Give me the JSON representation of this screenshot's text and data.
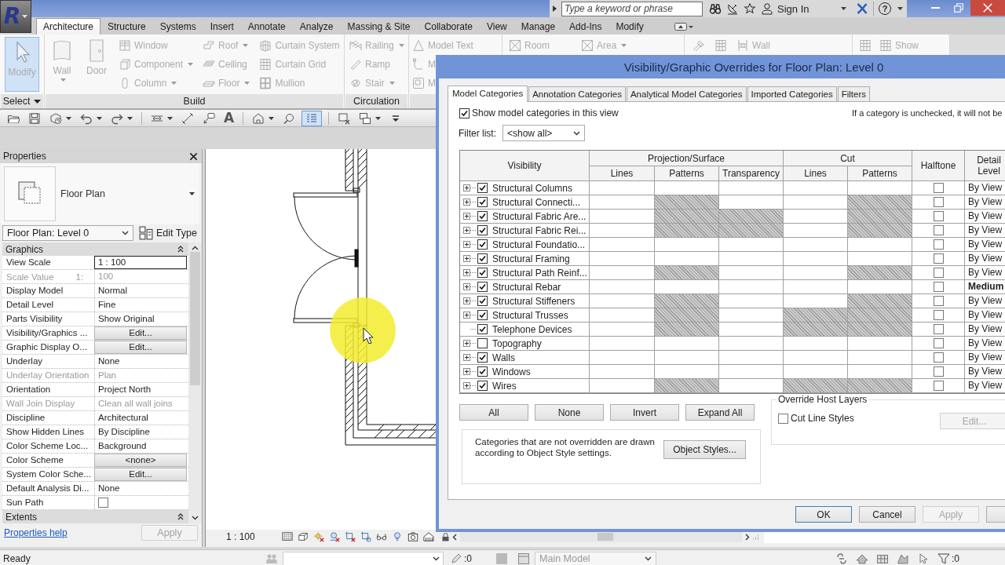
{
  "app_menu": {
    "logo": "R"
  },
  "title_bar": {
    "search": {
      "placeholder": "Type a keyword or phrase"
    },
    "sign_in": "Sign In",
    "help": "?"
  },
  "ribbon_tabs": [
    {
      "label": "Architecture",
      "selected": true
    },
    {
      "label": "Structure",
      "selected": false
    },
    {
      "label": "Systems",
      "selected": false
    },
    {
      "label": "Insert",
      "selected": false
    },
    {
      "label": "Annotate",
      "selected": false
    },
    {
      "label": "Analyze",
      "selected": false
    },
    {
      "label": "Massing & Site",
      "selected": false
    },
    {
      "label": "Collaborate",
      "selected": false
    },
    {
      "label": "View",
      "selected": false
    },
    {
      "label": "Manage",
      "selected": false
    },
    {
      "label": "Add-Ins",
      "selected": false
    },
    {
      "label": "Modify",
      "selected": false
    }
  ],
  "ribbon_panels": [
    {
      "label": "Select",
      "dropdown": true,
      "columns": [
        [
          {
            "label": "Modify",
            "kind": "large",
            "dropdown": false,
            "active": true,
            "disabled": true
          }
        ]
      ]
    },
    {
      "label": "Build",
      "dropdown": false,
      "columns": [
        [
          {
            "label": "Wall",
            "kind": "large",
            "dropdown": true,
            "active": false,
            "disabled": true
          }
        ],
        [
          {
            "label": "Door",
            "kind": "large",
            "dropdown": false,
            "active": false,
            "disabled": true
          }
        ],
        [
          {
            "label": "Window",
            "kind": "small",
            "dropdown": false,
            "active": false,
            "disabled": true
          },
          {
            "label": "Component",
            "kind": "small",
            "dropdown": true,
            "active": false,
            "disabled": true
          },
          {
            "label": "Column",
            "kind": "small",
            "dropdown": true,
            "active": false,
            "disabled": true
          }
        ],
        [
          {
            "label": "Roof",
            "kind": "small",
            "dropdown": true,
            "active": false,
            "disabled": true
          },
          {
            "label": "Ceiling",
            "kind": "small",
            "dropdown": false,
            "active": false,
            "disabled": true
          },
          {
            "label": "Floor",
            "kind": "small",
            "dropdown": true,
            "active": false,
            "disabled": true
          }
        ],
        [
          {
            "label": "Curtain System",
            "kind": "small",
            "dropdown": false,
            "active": false,
            "disabled": true
          },
          {
            "label": "Curtain Grid",
            "kind": "small",
            "dropdown": false,
            "active": false,
            "disabled": true
          },
          {
            "label": "Mullion",
            "kind": "small",
            "dropdown": false,
            "active": false,
            "disabled": true
          }
        ]
      ]
    },
    {
      "label": "Circulation",
      "dropdown": false,
      "columns": [
        [
          {
            "label": "Railing",
            "kind": "small",
            "dropdown": true,
            "active": false,
            "disabled": true
          },
          {
            "label": "Ramp",
            "kind": "small",
            "dropdown": false,
            "active": false,
            "disabled": true
          },
          {
            "label": "Stair",
            "kind": "small",
            "dropdown": true,
            "active": false,
            "disabled": true
          }
        ]
      ]
    },
    {
      "columns": [
        [
          {
            "label": "Model Text",
            "kind": "small",
            "dropdown": false,
            "active": false,
            "disabled": true
          },
          {
            "label": "M",
            "kind": "small",
            "dropdown": false,
            "active": false,
            "disabled": true
          },
          {
            "label": "M",
            "kind": "small",
            "dropdown": false,
            "active": false,
            "disabled": true
          }
        ]
      ]
    },
    {
      "columns": [
        [
          {
            "label": "Room",
            "kind": "small",
            "dropdown": false,
            "active": false,
            "disabled": true
          }
        ],
        [
          {
            "label": "Area",
            "kind": "small",
            "dropdown": true,
            "active": false,
            "disabled": true
          }
        ]
      ]
    },
    {
      "columns": [
        [
          {
            "kind": "small",
            "dropdown": false,
            "active": false,
            "disabled": true
          }
        ],
        [
          {
            "kind": "small",
            "dropdown": false,
            "active": false,
            "disabled": true
          }
        ],
        [
          {
            "label": "Wall",
            "kind": "small",
            "dropdown": false,
            "active": false,
            "disabled": true
          }
        ]
      ]
    },
    {
      "columns": [
        [
          {
            "kind": "small",
            "dropdown": false,
            "active": false,
            "disabled": true
          }
        ],
        [
          {
            "label": "Show",
            "kind": "small",
            "dropdown": false,
            "active": false,
            "disabled": true
          }
        ]
      ]
    }
  ],
  "quick_access": [
    {
      "kind": "button",
      "dropdown": false,
      "active": false
    },
    {
      "kind": "button",
      "dropdown": false,
      "active": false
    },
    {
      "kind": "button",
      "dropdown": true,
      "active": false
    },
    {
      "kind": "button",
      "dropdown": true,
      "active": false
    },
    {
      "kind": "button",
      "dropdown": true,
      "active": false
    },
    {
      "kind": "separator"
    },
    {
      "kind": "button",
      "dropdown": true,
      "active": false
    },
    {
      "kind": "button",
      "dropdown": false,
      "active": false
    },
    {
      "kind": "button",
      "dropdown": false,
      "active": false
    },
    {
      "kind": "glyph",
      "label": "A",
      "dropdown": false,
      "active": false
    },
    {
      "kind": "separator"
    },
    {
      "kind": "button",
      "dropdown": true,
      "active": false
    },
    {
      "kind": "button",
      "dropdown": false,
      "active": false
    },
    {
      "kind": "button",
      "dropdown": false,
      "active": true
    },
    {
      "kind": "separator"
    },
    {
      "kind": "button",
      "dropdown": false,
      "active": false
    },
    {
      "kind": "button",
      "dropdown": true,
      "active": false
    },
    {
      "kind": "button",
      "dropdown": false,
      "active": false
    }
  ],
  "properties": {
    "title": "Properties",
    "type_name": "Floor Plan",
    "instance": "Floor Plan: Level 0",
    "edit_type": "Edit Type",
    "groups": [
      {
        "label": "Graphics",
        "rows": [
          {
            "label": "View Scale",
            "value": "1 : 100",
            "kind": "input",
            "disabled": false
          },
          {
            "label": "Scale Value",
            "label_suffix": "1:",
            "value": "100",
            "kind": "text",
            "disabled": true
          },
          {
            "label": "Display Model",
            "value": "Normal",
            "kind": "text",
            "disabled": false
          },
          {
            "label": "Detail Level",
            "value": "Fine",
            "kind": "text",
            "disabled": false
          },
          {
            "label": "Parts Visibility",
            "value": "Show Original",
            "kind": "text",
            "disabled": false
          },
          {
            "label": "Visibility/Graphics ...",
            "value": "Edit...",
            "kind": "button",
            "disabled": false
          },
          {
            "label": "Graphic Display O...",
            "value": "Edit...",
            "kind": "button",
            "disabled": false
          },
          {
            "label": "Underlay",
            "value": "None",
            "kind": "text",
            "disabled": false
          },
          {
            "label": "Underlay Orientation",
            "value": "Plan",
            "kind": "text",
            "disabled": true
          },
          {
            "label": "Orientation",
            "value": "Project North",
            "kind": "text",
            "disabled": false
          },
          {
            "label": "Wall Join Display",
            "value": "Clean all wall joins",
            "kind": "text",
            "disabled": true
          },
          {
            "label": "Discipline",
            "value": "Architectural",
            "kind": "text",
            "disabled": false
          },
          {
            "label": "Show Hidden Lines",
            "value": "By Discipline",
            "kind": "text",
            "disabled": false
          },
          {
            "label": "Color Scheme Loc...",
            "value": "Background",
            "kind": "text",
            "disabled": false
          },
          {
            "label": "Color Scheme",
            "value": "<none>",
            "kind": "button",
            "disabled": false
          },
          {
            "label": "System Color Sche...",
            "value": "Edit...",
            "kind": "button",
            "disabled": false
          },
          {
            "label": "Default Analysis Di...",
            "value": "None",
            "kind": "text",
            "disabled": false
          },
          {
            "label": "Sun Path",
            "kind": "checkbox",
            "checked": false,
            "disabled": false
          }
        ]
      },
      {
        "label": "Extents"
      }
    ],
    "help_link": "Properties help",
    "apply": {
      "label": "Apply",
      "disabled": true
    }
  },
  "view_bar": {
    "scale": "1 : 100"
  },
  "dialog": {
    "title": "Visibility/Graphic Overrides for Floor Plan: Level 0",
    "tabs": [
      {
        "label": "Model Categories",
        "selected": true
      },
      {
        "label": "Annotation Categories",
        "selected": false
      },
      {
        "label": "Analytical Model Categories",
        "selected": false
      },
      {
        "label": "Imported Categories",
        "selected": false
      },
      {
        "label": "Filters",
        "selected": false
      }
    ],
    "show_categories": {
      "label": "Show model categories in this view",
      "checked": true
    },
    "note": "If a category is unchecked, it will not be",
    "filter": {
      "label": "Filter list:",
      "value": "<show all>"
    },
    "table": {
      "columns": [
        {
          "label": "Visibility"
        },
        {
          "label": "Projection/Surface",
          "children": [
            {
              "label": "Lines"
            },
            {
              "label": "Patterns"
            },
            {
              "label": "Transparency"
            }
          ]
        },
        {
          "label": "Cut",
          "children": [
            {
              "label": "Lines"
            },
            {
              "label": "Patterns"
            }
          ]
        },
        {
          "label": "Halftone"
        },
        {
          "label": "Detail Level"
        }
      ],
      "rows": [
        {
          "name": "Structural Columns",
          "checked": true,
          "expandable": true,
          "hatched": [
            false,
            false,
            false,
            false,
            false
          ],
          "halftone": false,
          "detail_level": "By View",
          "overridden": false
        },
        {
          "name": "Structural Connecti...",
          "checked": true,
          "expandable": true,
          "hatched": [
            false,
            true,
            false,
            false,
            true
          ],
          "halftone": false,
          "detail_level": "By View",
          "overridden": false
        },
        {
          "name": "Structural Fabric Are...",
          "checked": true,
          "expandable": true,
          "hatched": [
            false,
            true,
            true,
            false,
            true
          ],
          "halftone": false,
          "detail_level": "By View",
          "overridden": false
        },
        {
          "name": "Structural Fabric Rei...",
          "checked": true,
          "expandable": true,
          "hatched": [
            false,
            true,
            true,
            false,
            true
          ],
          "halftone": false,
          "detail_level": "By View",
          "overridden": false
        },
        {
          "name": "Structural Foundatio...",
          "checked": true,
          "expandable": true,
          "hatched": [
            false,
            false,
            false,
            false,
            false
          ],
          "halftone": false,
          "detail_level": "By View",
          "overridden": false
        },
        {
          "name": "Structural Framing",
          "checked": true,
          "expandable": true,
          "hatched": [
            false,
            false,
            false,
            false,
            false
          ],
          "halftone": false,
          "detail_level": "By View",
          "overridden": false
        },
        {
          "name": "Structural Path Reinf...",
          "checked": true,
          "expandable": true,
          "hatched": [
            false,
            true,
            false,
            false,
            true
          ],
          "halftone": false,
          "detail_level": "By View",
          "overridden": false
        },
        {
          "name": "Structural Rebar",
          "checked": true,
          "expandable": true,
          "hatched": [
            false,
            false,
            false,
            false,
            false
          ],
          "halftone": false,
          "detail_level": "Medium",
          "overridden": true
        },
        {
          "name": "Structural Stiffeners",
          "checked": true,
          "expandable": true,
          "hatched": [
            false,
            true,
            false,
            false,
            true
          ],
          "halftone": false,
          "detail_level": "By View",
          "overridden": false
        },
        {
          "name": "Structural Trusses",
          "checked": true,
          "expandable": true,
          "hatched": [
            false,
            true,
            false,
            true,
            true
          ],
          "halftone": false,
          "detail_level": "By View",
          "overridden": false
        },
        {
          "name": "Telephone Devices",
          "checked": true,
          "expandable": false,
          "hatched": [
            false,
            true,
            false,
            true,
            true
          ],
          "halftone": false,
          "detail_level": "By View",
          "overridden": false
        },
        {
          "name": "Topography",
          "checked": false,
          "expandable": true,
          "hatched": [
            false,
            false,
            false,
            false,
            false
          ],
          "halftone": false,
          "detail_level": "By View",
          "overridden": false
        },
        {
          "name": "Walls",
          "checked": true,
          "expandable": true,
          "hatched": [
            false,
            false,
            false,
            false,
            false
          ],
          "halftone": false,
          "detail_level": "By View",
          "overridden": false
        },
        {
          "name": "Windows",
          "checked": true,
          "expandable": true,
          "hatched": [
            false,
            false,
            false,
            false,
            false
          ],
          "halftone": false,
          "detail_level": "By View",
          "overridden": false
        },
        {
          "name": "Wires",
          "checked": true,
          "expandable": true,
          "hatched": [
            false,
            true,
            false,
            true,
            true
          ],
          "halftone": false,
          "detail_level": "By View",
          "overridden": false
        }
      ]
    },
    "list_buttons": [
      "All",
      "None",
      "Invert",
      "Expand All"
    ],
    "info": {
      "text": "Categories that are not overridden are drawn according to Object Style settings.",
      "button": "Object Styles..."
    },
    "host_layers": {
      "title": "Override Host Layers",
      "checkbox": {
        "label": "Cut Line Styles",
        "checked": false
      },
      "edit": {
        "label": "Edit...",
        "disabled": true
      }
    },
    "footer_buttons": [
      {
        "label": "OK",
        "disabled": false,
        "default": true
      },
      {
        "label": "Cancel",
        "disabled": false,
        "default": false
      },
      {
        "label": "Apply",
        "disabled": true,
        "default": false
      },
      {
        "disabled": false,
        "default": false
      }
    ]
  },
  "status_bar": {
    "text": "Ready",
    "edit_count": ":0",
    "model": {
      "label": "Main Model",
      "disabled": true
    },
    "filter_count": ":0"
  }
}
